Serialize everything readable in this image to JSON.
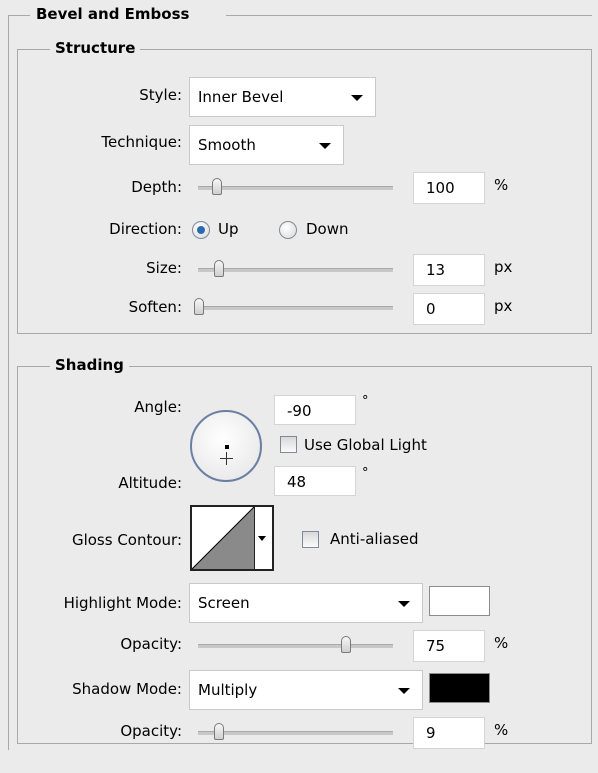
{
  "panel": {
    "title": "Bevel and Emboss"
  },
  "structure": {
    "title": "Structure",
    "style": {
      "label": "Style:",
      "value": "Inner Bevel"
    },
    "technique": {
      "label": "Technique:",
      "value": "Smooth"
    },
    "depth": {
      "label": "Depth:",
      "value": "100",
      "unit": "%",
      "slider_fraction": 0.09
    },
    "direction": {
      "label": "Direction:",
      "up": "Up",
      "down": "Down",
      "selected": "Up"
    },
    "size": {
      "label": "Size:",
      "value": "13",
      "unit": "px",
      "slider_fraction": 0.09
    },
    "soften": {
      "label": "Soften:",
      "value": "0",
      "unit": "px",
      "slider_fraction": 0.0
    }
  },
  "shading": {
    "title": "Shading",
    "angle": {
      "label": "Angle:",
      "value": "-90",
      "unit": "°"
    },
    "use_global_light": {
      "label": "Use Global Light",
      "checked": false
    },
    "altitude": {
      "label": "Altitude:",
      "value": "48",
      "unit": "°"
    },
    "gloss_contour": {
      "label": "Gloss Contour:"
    },
    "anti_aliased": {
      "label": "Anti-aliased",
      "checked": false
    },
    "highlight_mode": {
      "label": "Highlight Mode:",
      "value": "Screen",
      "color": "#ffffff"
    },
    "highlight_opacity": {
      "label": "Opacity:",
      "value": "75",
      "unit": "%",
      "slider_fraction": 0.75
    },
    "shadow_mode": {
      "label": "Shadow Mode:",
      "value": "Multiply",
      "color": "#000000"
    },
    "shadow_opacity": {
      "label": "Opacity:",
      "value": "9",
      "unit": "%",
      "slider_fraction": 0.09
    }
  },
  "icons": [
    "dropdown-arrow-icon",
    "slider-thumb-icon",
    "angle-dial-icon",
    "contour-preview-icon"
  ]
}
